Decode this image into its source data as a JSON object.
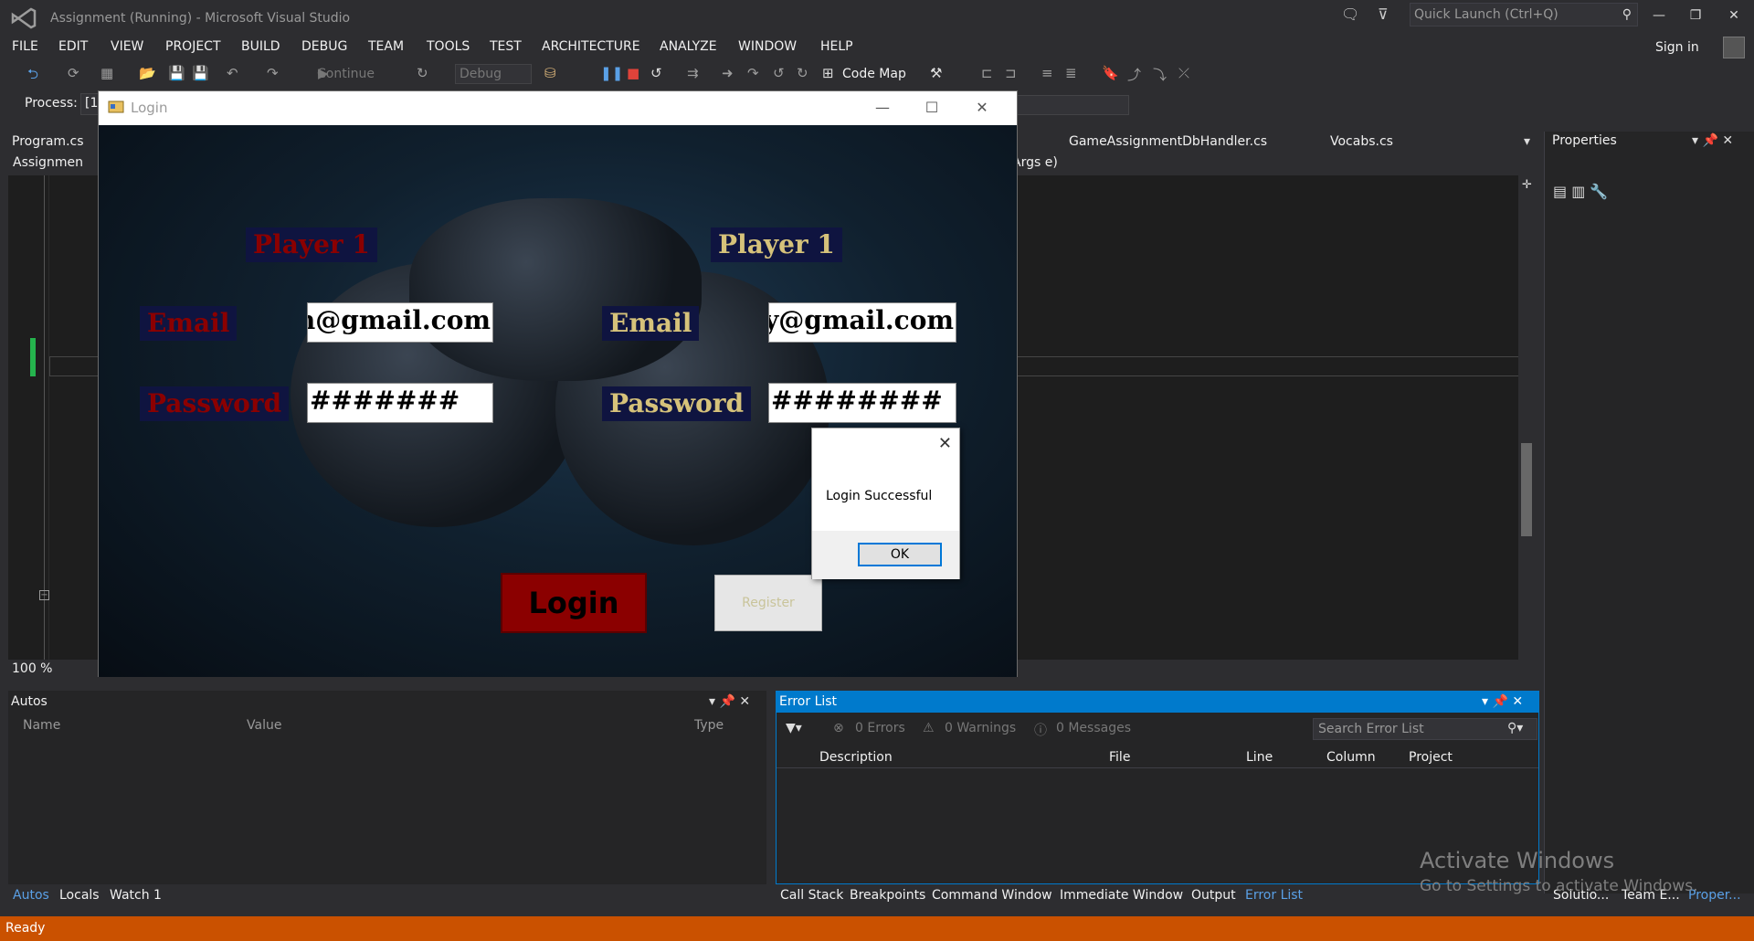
{
  "window": {
    "title": "Assignment (Running) - Microsoft Visual Studio"
  },
  "quick_launch": {
    "placeholder": "Quick Launch (Ctrl+Q)"
  },
  "menu": [
    "FILE",
    "EDIT",
    "VIEW",
    "PROJECT",
    "BUILD",
    "DEBUG",
    "TEAM",
    "TOOLS",
    "TEST",
    "ARCHITECTURE",
    "ANALYZE",
    "WINDOW",
    "HELP"
  ],
  "signin": "Sign in",
  "toolbar": {
    "continue": "Continue",
    "config": "Debug",
    "codemap": "Code Map"
  },
  "process": {
    "label": "Process:",
    "value": "[1"
  },
  "tabs": {
    "program": "Program.cs",
    "handler": "GameAssignmentDbHandler.cs",
    "vocabs": "Vocabs.cs"
  },
  "nav": {
    "left": "Assignmen",
    "right": "Args e)"
  },
  "zoom": "100 %",
  "properties": {
    "title": "Properties"
  },
  "autos": {
    "title": "Autos",
    "columns": [
      "Name",
      "Value",
      "Type"
    ]
  },
  "error_list": {
    "title": "Error List",
    "errors": "0 Errors",
    "warnings": "0 Warnings",
    "messages": "0 Messages",
    "search": "Search Error List",
    "columns": [
      "Description",
      "File",
      "Line",
      "Column",
      "Project"
    ]
  },
  "bottom_tabs_left": [
    "Autos",
    "Locals",
    "Watch 1"
  ],
  "bottom_tabs_right": [
    "Call Stack",
    "Breakpoints",
    "Command Window",
    "Immediate Window",
    "Output",
    "Error List"
  ],
  "right_tabs": [
    "Solutio...",
    "Team E...",
    "Proper..."
  ],
  "status": "Ready",
  "activate": {
    "line1": "Activate Windows",
    "line2": "Go to Settings to activate Windows."
  },
  "login_form": {
    "title": "Login",
    "player_left": "Player 1",
    "player_right": "Player 1",
    "email_label": "Email",
    "password_label": "Password",
    "email_left": "n@gmail.com",
    "email_right": "y@gmail.com",
    "password_left": "#######",
    "password_right": "########",
    "login_button": "Login",
    "register_button": "Register"
  },
  "message_box": {
    "text": "Login Successful",
    "ok": "OK"
  },
  "colors": {
    "accent": "#007acc",
    "status": "#ca5100",
    "login_button": "#8b0000"
  }
}
